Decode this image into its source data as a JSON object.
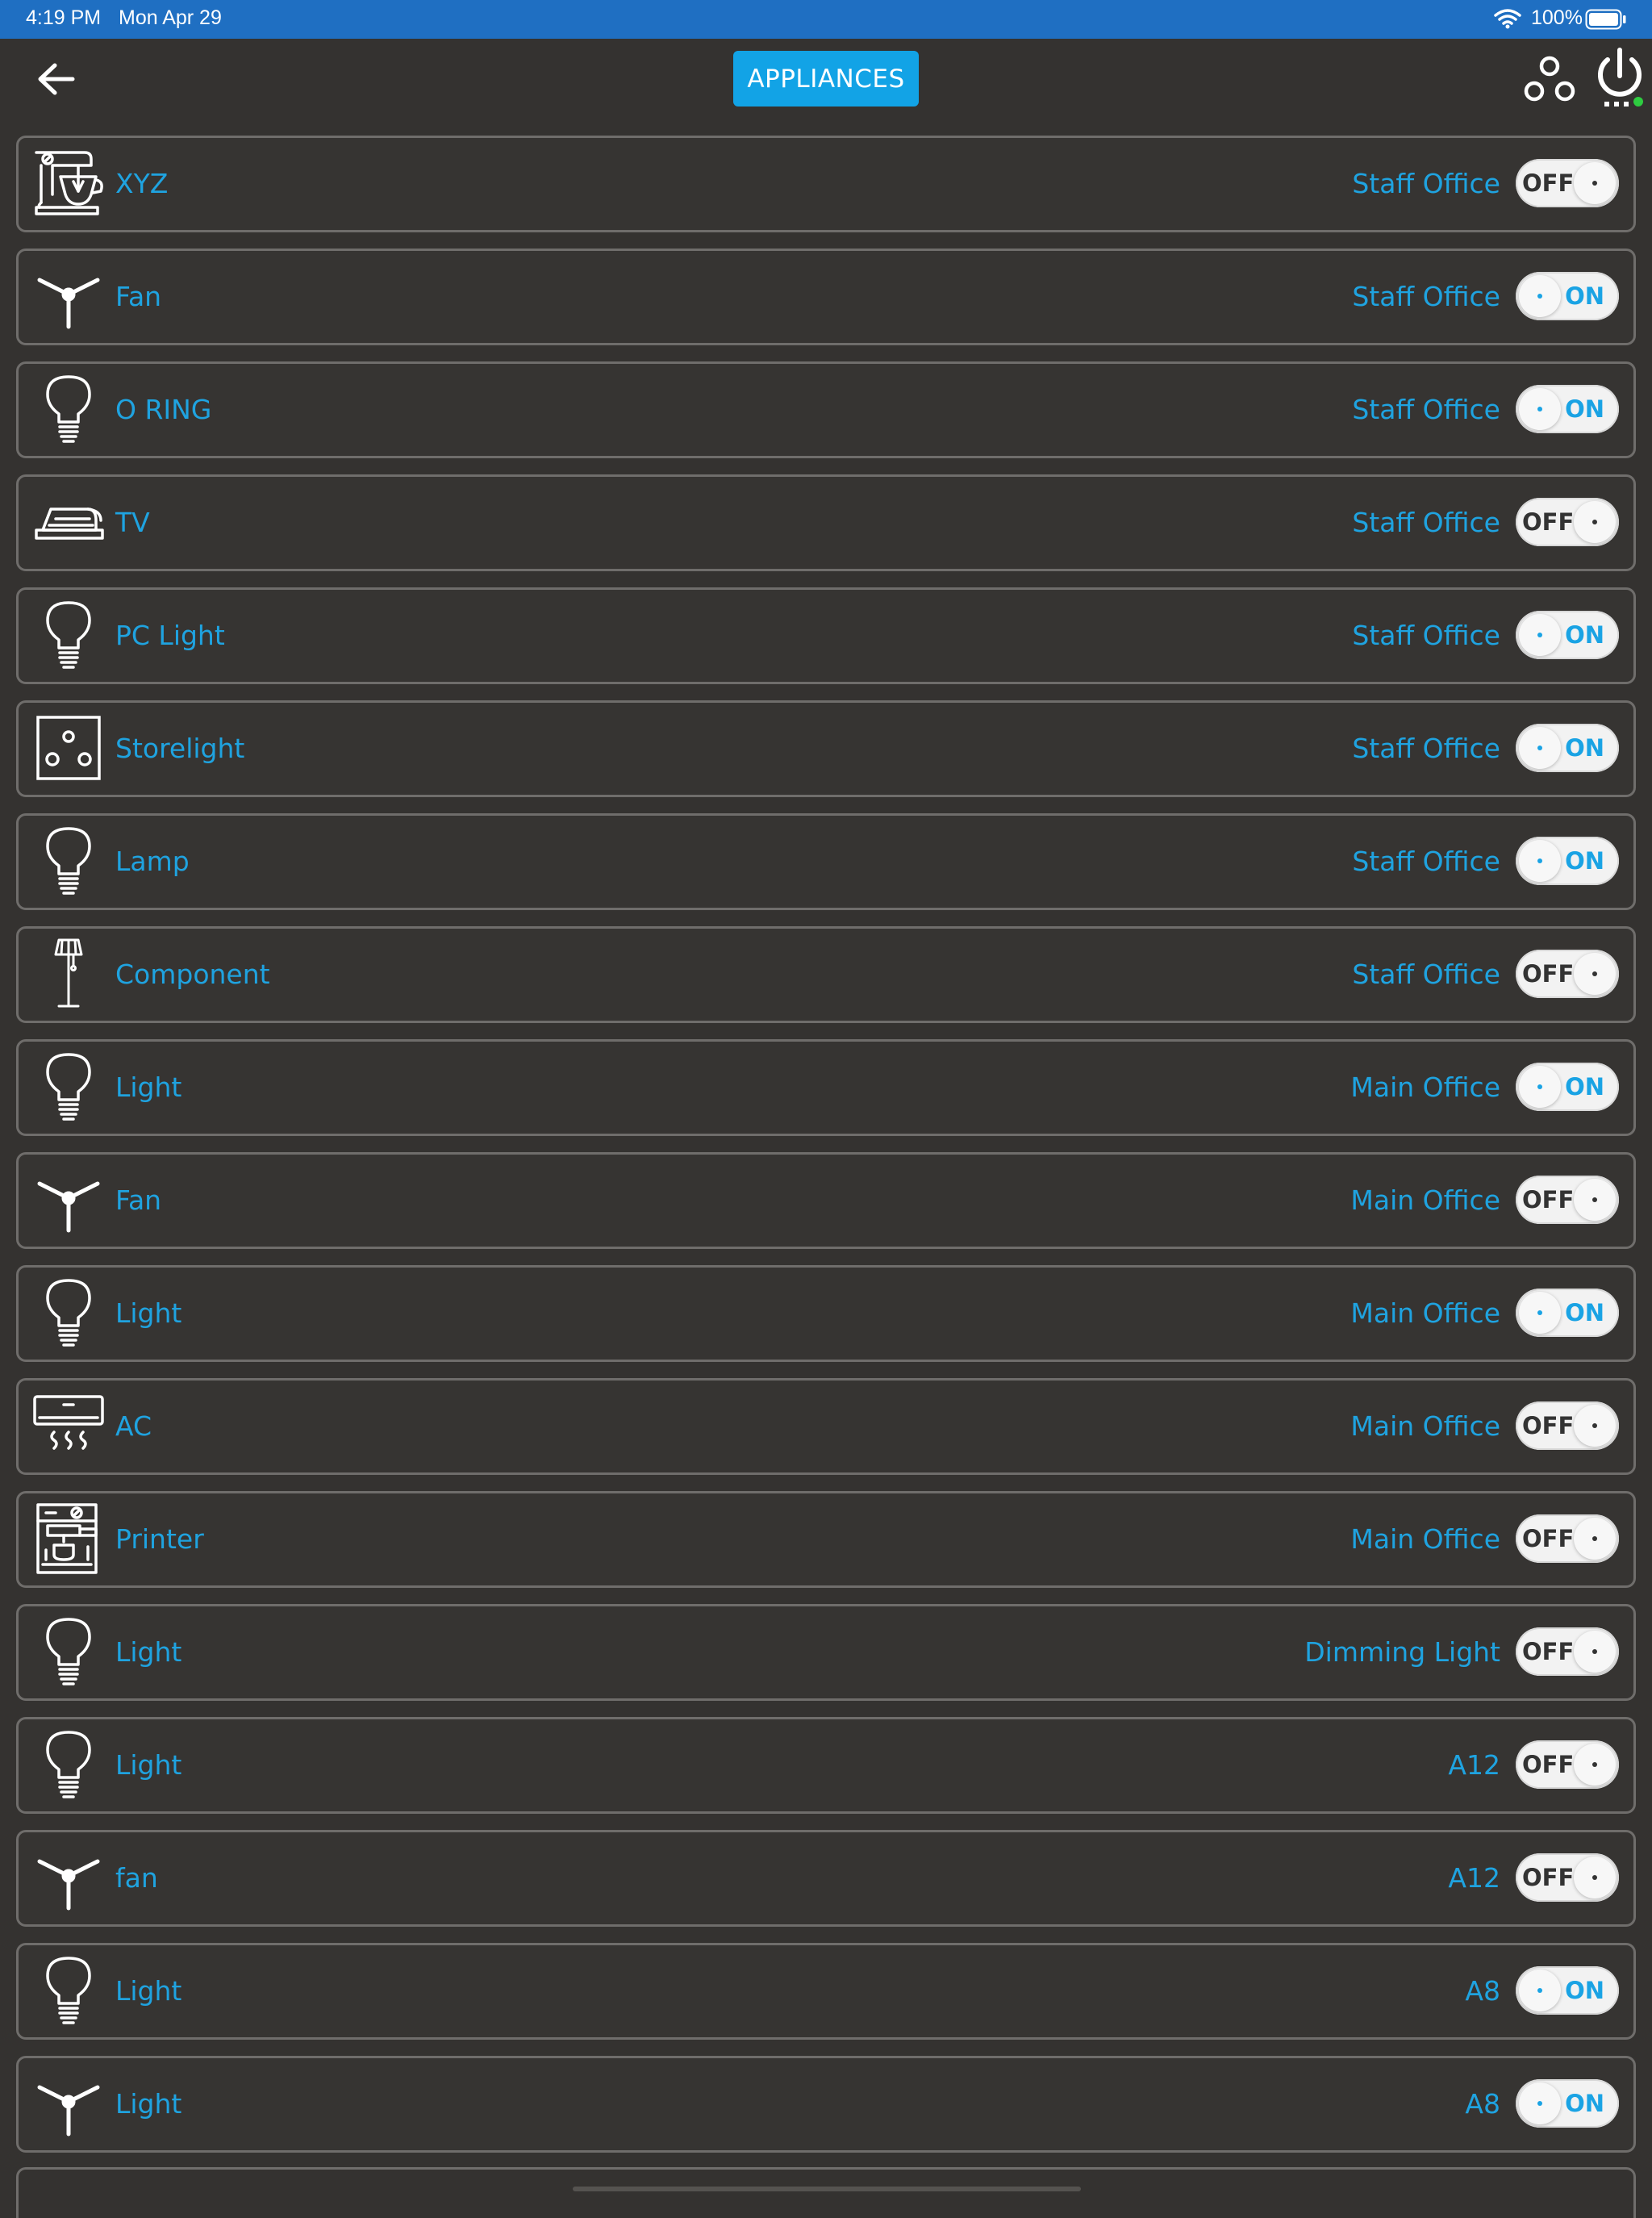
{
  "status_bar": {
    "time": "4:19 PM",
    "date": "Mon Apr 29",
    "battery": "100%"
  },
  "header": {
    "title": "APPLIANCES",
    "back_icon": "arrow-left-icon",
    "scenes_icon": "three-circles-icon",
    "power_icon": "power-icon"
  },
  "colors": {
    "accent": "#1fa3e0",
    "title_button": "#12a3e6",
    "background": "#343230",
    "status_bar": "#1f6fc2",
    "online_dot": "#2ecc40"
  },
  "appliances": [
    {
      "name": "XYZ",
      "room": "Staff Office",
      "state": "OFF",
      "icon": "mixer-icon"
    },
    {
      "name": "Fan",
      "room": "Staff Office",
      "state": "ON",
      "icon": "fan-icon"
    },
    {
      "name": "O RING",
      "room": "Staff Office",
      "state": "ON",
      "icon": "bulb-icon"
    },
    {
      "name": "TV",
      "room": "Staff Office",
      "state": "OFF",
      "icon": "iron-icon"
    },
    {
      "name": "PC Light",
      "room": "Staff Office",
      "state": "ON",
      "icon": "bulb-icon"
    },
    {
      "name": "Storelight",
      "room": "Staff Office",
      "state": "ON",
      "icon": "socket-icon"
    },
    {
      "name": "Lamp",
      "room": "Staff Office",
      "state": "ON",
      "icon": "bulb-icon"
    },
    {
      "name": "Component",
      "room": "Staff Office",
      "state": "OFF",
      "icon": "floor-lamp-icon"
    },
    {
      "name": "Light",
      "room": "Main Office",
      "state": "ON",
      "icon": "bulb-icon"
    },
    {
      "name": "Fan",
      "room": "Main Office",
      "state": "OFF",
      "icon": "fan-icon"
    },
    {
      "name": "Light",
      "room": "Main Office",
      "state": "ON",
      "icon": "bulb-icon"
    },
    {
      "name": "AC",
      "room": "Main Office",
      "state": "OFF",
      "icon": "ac-icon"
    },
    {
      "name": "Printer",
      "room": "Main Office",
      "state": "OFF",
      "icon": "coffee-machine-icon"
    },
    {
      "name": "Light",
      "room": "Dimming Light",
      "state": "OFF",
      "icon": "bulb-icon"
    },
    {
      "name": "Light",
      "room": "A12",
      "state": "OFF",
      "icon": "bulb-icon"
    },
    {
      "name": "fan",
      "room": "A12",
      "state": "OFF",
      "icon": "fan-icon"
    },
    {
      "name": "Light",
      "room": "A8",
      "state": "ON",
      "icon": "bulb-icon"
    },
    {
      "name": "Light",
      "room": "A8",
      "state": "ON",
      "icon": "fan-icon"
    }
  ]
}
